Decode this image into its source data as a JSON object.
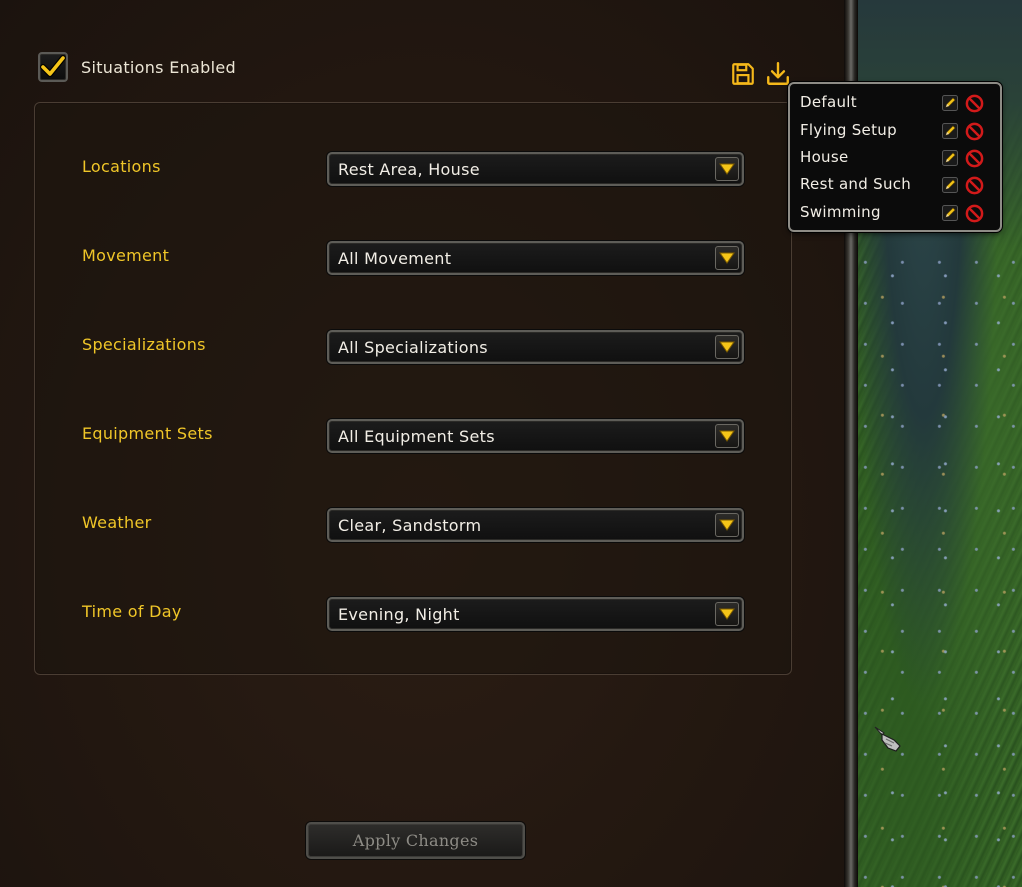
{
  "header": {
    "situations_enabled_label": "Situations Enabled",
    "situations_enabled_checked": true,
    "save_icon": "save-icon",
    "download_icon": "download-icon"
  },
  "settings": {
    "rows": [
      {
        "label": "Locations",
        "value": "Rest Area, House"
      },
      {
        "label": "Movement",
        "value": "All Movement"
      },
      {
        "label": "Specializations",
        "value": "All Specializations"
      },
      {
        "label": "Equipment Sets",
        "value": "All Equipment Sets"
      },
      {
        "label": "Weather",
        "value": "Clear, Sandstorm"
      },
      {
        "label": "Time of Day",
        "value": "Evening, Night"
      }
    ]
  },
  "footer": {
    "apply_label": "Apply Changes"
  },
  "profiles_popup": {
    "items": [
      {
        "label": "Default"
      },
      {
        "label": "Flying Setup"
      },
      {
        "label": "House"
      },
      {
        "label": "Rest and Such"
      },
      {
        "label": "Swimming"
      }
    ],
    "edit_icon": "pencil-icon",
    "delete_icon": "delete-icon"
  },
  "colors": {
    "label_gold": "#f0c628",
    "text_white": "#f2eee6",
    "check_yellow": "#f5c518",
    "delete_red": "#d21a1a"
  }
}
